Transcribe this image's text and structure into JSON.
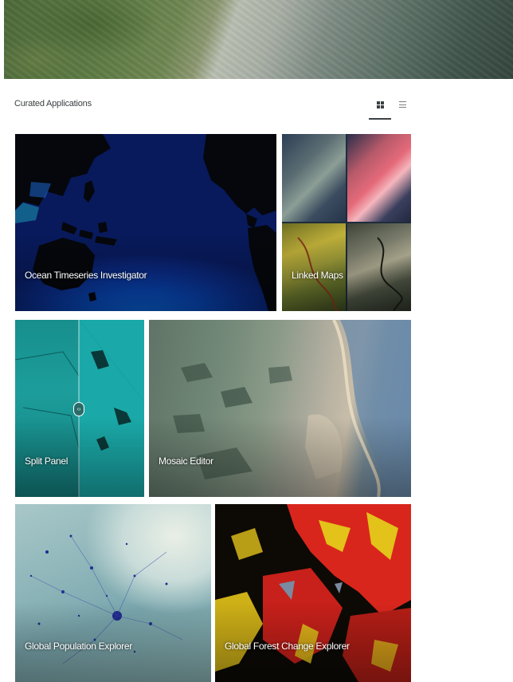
{
  "section": {
    "title": "Curated Applications",
    "view_toggle": {
      "grid_icon": "grid-view-icon",
      "list_icon": "list-view-icon",
      "active": "grid"
    }
  },
  "apps": [
    {
      "id": "ocean",
      "label": "Ocean Timeseries Investigator"
    },
    {
      "id": "linked",
      "label": "Linked Maps"
    },
    {
      "id": "split",
      "label": "Split Panel"
    },
    {
      "id": "mosaic",
      "label": "Mosaic Editor"
    },
    {
      "id": "pop",
      "label": "Global Population Explorer"
    },
    {
      "id": "forest",
      "label": "Global Forest Change Explorer"
    }
  ],
  "colors": {
    "text_primary": "#3c4043",
    "card_label": "#ffffff",
    "ocean_blue": "#0d53c8",
    "split_teal": "#1aa9a8",
    "forest_red": "#d9261c",
    "forest_yellow": "#e3c21a"
  }
}
